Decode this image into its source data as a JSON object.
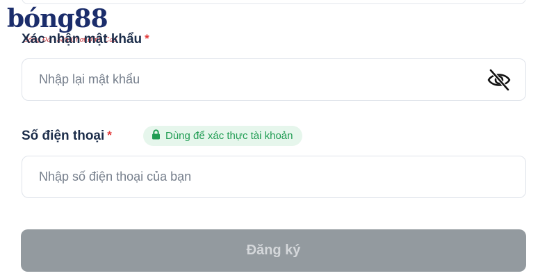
{
  "watermark": {
    "logo_text": "bóng88",
    "tagline": "Bóng Đá - Sân Chơi Đỉnh Cao"
  },
  "confirm_password": {
    "label": "Xác nhận mật khẩu",
    "required_mark": "*",
    "placeholder": "Nhập lại mật khẩu",
    "value": "",
    "toggle_icon": "eye-off-icon"
  },
  "phone": {
    "label": "Số điện thoại",
    "required_mark": "*",
    "badge_icon": "lock-icon",
    "badge_text": "Dùng để xác thực tài khoản",
    "placeholder": "Nhập số điện thoại của bạn",
    "value": ""
  },
  "submit": {
    "label": "Đăng ký"
  },
  "colors": {
    "label_text": "#1c2d4a",
    "required": "#e23a3a",
    "badge_bg": "#e6f6ec",
    "badge_text": "#1f9c52",
    "button_disabled_bg": "#939a9f",
    "button_disabled_text": "#d4d7da",
    "logo": "#1b2d6b"
  }
}
